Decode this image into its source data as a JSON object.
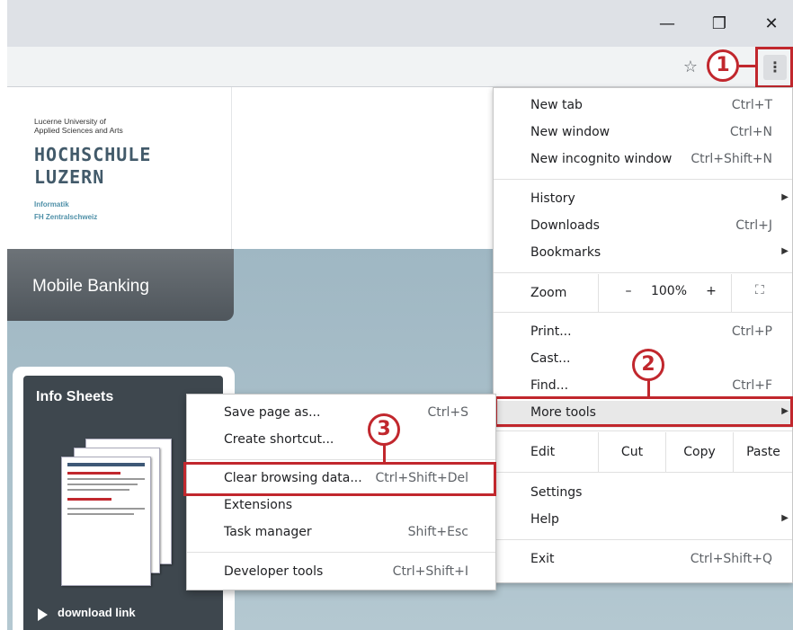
{
  "window": {
    "minimize_glyph": "—",
    "restore_glyph": "❐",
    "close_glyph": "✕",
    "bookmark_star_glyph": "☆",
    "menu_glyph": "⋮"
  },
  "logo": {
    "line1": "Lucerne University of",
    "line2": "Applied Sciences and Arts",
    "name1": "HOCHSCHULE",
    "name2": "LUZERN",
    "dept1": "Informatik",
    "dept2": "FH Zentralschweiz"
  },
  "page": {
    "banner_title": "Mobile Banking",
    "info_title": "Info Sheets",
    "download_label": "download link"
  },
  "main_menu": {
    "new_tab": {
      "label": "New tab",
      "shortcut": "Ctrl+T"
    },
    "new_window": {
      "label": "New window",
      "shortcut": "Ctrl+N"
    },
    "new_incognito": {
      "label": "New incognito window",
      "shortcut": "Ctrl+Shift+N"
    },
    "history": {
      "label": "History"
    },
    "downloads": {
      "label": "Downloads",
      "shortcut": "Ctrl+J"
    },
    "bookmarks": {
      "label": "Bookmarks"
    },
    "zoom": {
      "label": "Zoom",
      "minus": "–",
      "value": "100%",
      "plus": "+"
    },
    "print": {
      "label": "Print...",
      "shortcut": "Ctrl+P"
    },
    "cast": {
      "label": "Cast..."
    },
    "find": {
      "label": "Find...",
      "shortcut": "Ctrl+F"
    },
    "more_tools": {
      "label": "More tools"
    },
    "edit": {
      "label": "Edit",
      "cut": "Cut",
      "copy": "Copy",
      "paste": "Paste"
    },
    "settings": {
      "label": "Settings"
    },
    "help": {
      "label": "Help"
    },
    "exit": {
      "label": "Exit",
      "shortcut": "Ctrl+Shift+Q"
    }
  },
  "sub_menu": {
    "save_page": {
      "label": "Save page as...",
      "shortcut": "Ctrl+S"
    },
    "create_shortcut": {
      "label": "Create shortcut..."
    },
    "clear_data": {
      "label": "Clear browsing data...",
      "shortcut": "Ctrl+Shift+Del"
    },
    "extensions": {
      "label": "Extensions"
    },
    "task_manager": {
      "label": "Task manager",
      "shortcut": "Shift+Esc"
    },
    "dev_tools": {
      "label": "Developer tools",
      "shortcut": "Ctrl+Shift+I"
    }
  },
  "callouts": {
    "one": "1",
    "two": "2",
    "three": "3"
  },
  "colors": {
    "annotation_red": "#c1272d"
  }
}
